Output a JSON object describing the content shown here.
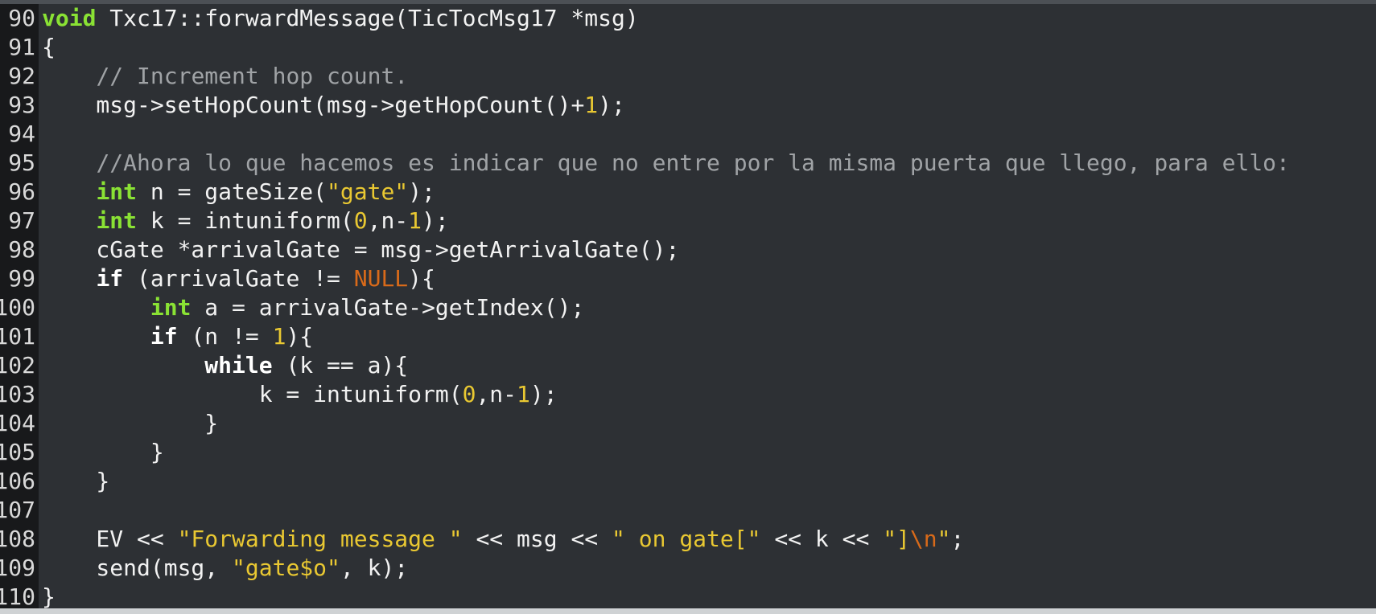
{
  "editor": {
    "theme_colors": {
      "background": "#2d3034",
      "gutter": "#18191b",
      "keyword_type": "#8ae234",
      "keyword_control": "#ffffff",
      "comment": "#a0a3a6",
      "string_number": "#e9c832",
      "special_constant": "#d86a1a",
      "text": "#f2f2f2"
    },
    "lines": [
      {
        "number": "90",
        "tokens": [
          {
            "type": "keyword",
            "text": "void"
          },
          {
            "type": "plain",
            "text": " Txc17::forwardMessage(TicTocMsg17 *msg)"
          }
        ]
      },
      {
        "number": "91",
        "tokens": [
          {
            "type": "plain",
            "text": "{"
          }
        ]
      },
      {
        "number": "92",
        "tokens": [
          {
            "type": "plain",
            "text": "    "
          },
          {
            "type": "comment",
            "text": "// Increment hop count."
          }
        ]
      },
      {
        "number": "93",
        "tokens": [
          {
            "type": "plain",
            "text": "    msg->setHopCount(msg->getHopCount()+"
          },
          {
            "type": "number",
            "text": "1"
          },
          {
            "type": "plain",
            "text": ");"
          }
        ]
      },
      {
        "number": "94",
        "tokens": []
      },
      {
        "number": "95",
        "tokens": [
          {
            "type": "plain",
            "text": "    "
          },
          {
            "type": "comment",
            "text": "//Ahora lo que hacemos es indicar que no entre por la misma puerta que llego, para ello:"
          }
        ]
      },
      {
        "number": "96",
        "tokens": [
          {
            "type": "plain",
            "text": "    "
          },
          {
            "type": "keyword",
            "text": "int"
          },
          {
            "type": "plain",
            "text": " n = gateSize("
          },
          {
            "type": "string",
            "text": "\"gate\""
          },
          {
            "type": "plain",
            "text": ");"
          }
        ]
      },
      {
        "number": "97",
        "tokens": [
          {
            "type": "plain",
            "text": "    "
          },
          {
            "type": "keyword",
            "text": "int"
          },
          {
            "type": "plain",
            "text": " k = intuniform("
          },
          {
            "type": "number",
            "text": "0"
          },
          {
            "type": "plain",
            "text": ",n-"
          },
          {
            "type": "number",
            "text": "1"
          },
          {
            "type": "plain",
            "text": ");"
          }
        ]
      },
      {
        "number": "98",
        "tokens": [
          {
            "type": "plain",
            "text": "    cGate *arrivalGate = msg->getArrivalGate();"
          }
        ]
      },
      {
        "number": "99",
        "tokens": [
          {
            "type": "plain",
            "text": "    "
          },
          {
            "type": "ctrl",
            "text": "if"
          },
          {
            "type": "plain",
            "text": " (arrivalGate != "
          },
          {
            "type": "special",
            "text": "NULL"
          },
          {
            "type": "plain",
            "text": "){"
          }
        ]
      },
      {
        "number": "100",
        "tokens": [
          {
            "type": "plain",
            "text": "        "
          },
          {
            "type": "keyword",
            "text": "int"
          },
          {
            "type": "plain",
            "text": " a = arrivalGate->getIndex();"
          }
        ]
      },
      {
        "number": "101",
        "tokens": [
          {
            "type": "plain",
            "text": "        "
          },
          {
            "type": "ctrl",
            "text": "if"
          },
          {
            "type": "plain",
            "text": " (n != "
          },
          {
            "type": "number",
            "text": "1"
          },
          {
            "type": "plain",
            "text": "){"
          }
        ]
      },
      {
        "number": "102",
        "tokens": [
          {
            "type": "plain",
            "text": "            "
          },
          {
            "type": "ctrl",
            "text": "while"
          },
          {
            "type": "plain",
            "text": " (k == a){"
          }
        ]
      },
      {
        "number": "103",
        "tokens": [
          {
            "type": "plain",
            "text": "                k = intuniform("
          },
          {
            "type": "number",
            "text": "0"
          },
          {
            "type": "plain",
            "text": ",n-"
          },
          {
            "type": "number",
            "text": "1"
          },
          {
            "type": "plain",
            "text": ");"
          }
        ]
      },
      {
        "number": "104",
        "tokens": [
          {
            "type": "plain",
            "text": "            }"
          }
        ]
      },
      {
        "number": "105",
        "tokens": [
          {
            "type": "plain",
            "text": "        }"
          }
        ]
      },
      {
        "number": "106",
        "tokens": [
          {
            "type": "plain",
            "text": "    }"
          }
        ]
      },
      {
        "number": "107",
        "tokens": []
      },
      {
        "number": "108",
        "tokens": [
          {
            "type": "plain",
            "text": "    EV << "
          },
          {
            "type": "string",
            "text": "\"Forwarding message \""
          },
          {
            "type": "plain",
            "text": " << msg << "
          },
          {
            "type": "string",
            "text": "\" on gate[\""
          },
          {
            "type": "plain",
            "text": " << k << "
          },
          {
            "type": "string",
            "text": "\"]"
          },
          {
            "type": "special",
            "text": "\\n"
          },
          {
            "type": "string",
            "text": "\""
          },
          {
            "type": "plain",
            "text": ";"
          }
        ]
      },
      {
        "number": "109",
        "tokens": [
          {
            "type": "plain",
            "text": "    send(msg, "
          },
          {
            "type": "string",
            "text": "\"gate$o\""
          },
          {
            "type": "plain",
            "text": ", k);"
          }
        ]
      },
      {
        "number": "110",
        "tokens": [
          {
            "type": "plain",
            "text": "}"
          }
        ]
      }
    ]
  }
}
